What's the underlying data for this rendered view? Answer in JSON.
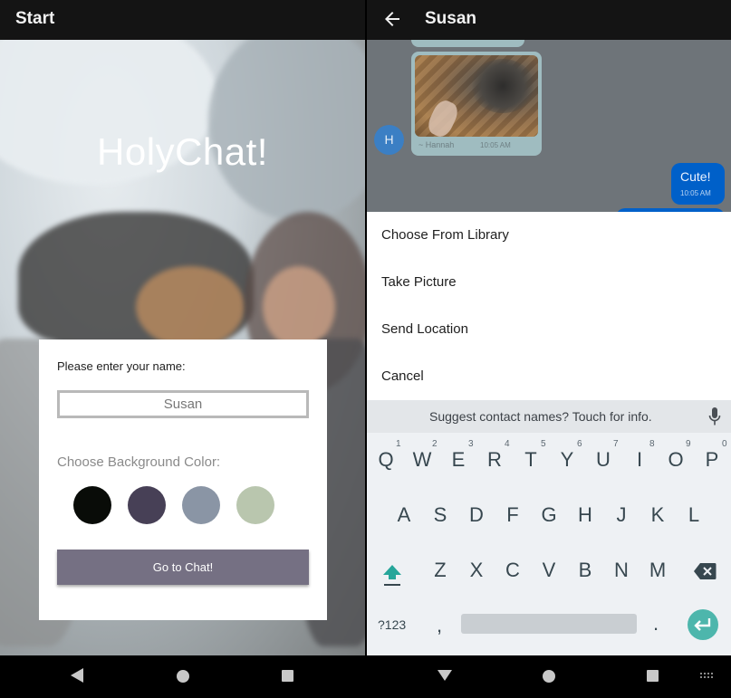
{
  "left_screen": {
    "header_title": "Start",
    "app_title": "HolyChat!",
    "form": {
      "name_label": "Please enter your name:",
      "name_value": "Susan",
      "color_label": "Choose Background Color:",
      "colors": [
        "#090C08",
        "#474056",
        "#8A95A5",
        "#B9C6AE"
      ],
      "go_button_label": "Go to Chat!"
    }
  },
  "right_screen": {
    "header_title": "Susan",
    "incoming_message": {
      "avatar_letter": "H",
      "sender": "~ Hannah",
      "time": "10:05 AM"
    },
    "outgoing_message": {
      "text": "Cute!",
      "time": "10:05 AM"
    },
    "action_sheet": {
      "items": [
        "Choose From Library",
        "Take Picture",
        "Send Location",
        "Cancel"
      ]
    },
    "keyboard": {
      "suggestion": "Suggest contact names? Touch for info.",
      "row1": [
        "Q",
        "W",
        "E",
        "R",
        "T",
        "Y",
        "U",
        "I",
        "O",
        "P"
      ],
      "row1_hints": [
        "1",
        "2",
        "3",
        "4",
        "5",
        "6",
        "7",
        "8",
        "9",
        "0"
      ],
      "row2": [
        "A",
        "S",
        "D",
        "F",
        "G",
        "H",
        "J",
        "K",
        "L"
      ],
      "row3": [
        "Z",
        "X",
        "C",
        "V",
        "B",
        "N",
        "M"
      ],
      "symbols_label": "?123",
      "comma": ",",
      "period": "."
    }
  },
  "colors": {
    "accent_button": "#757083",
    "outgoing_bubble": "#0060C9",
    "incoming_bubble": "#9FBCC0",
    "enter_key": "#4DB6AC",
    "shift_icon": "#26A69A"
  }
}
